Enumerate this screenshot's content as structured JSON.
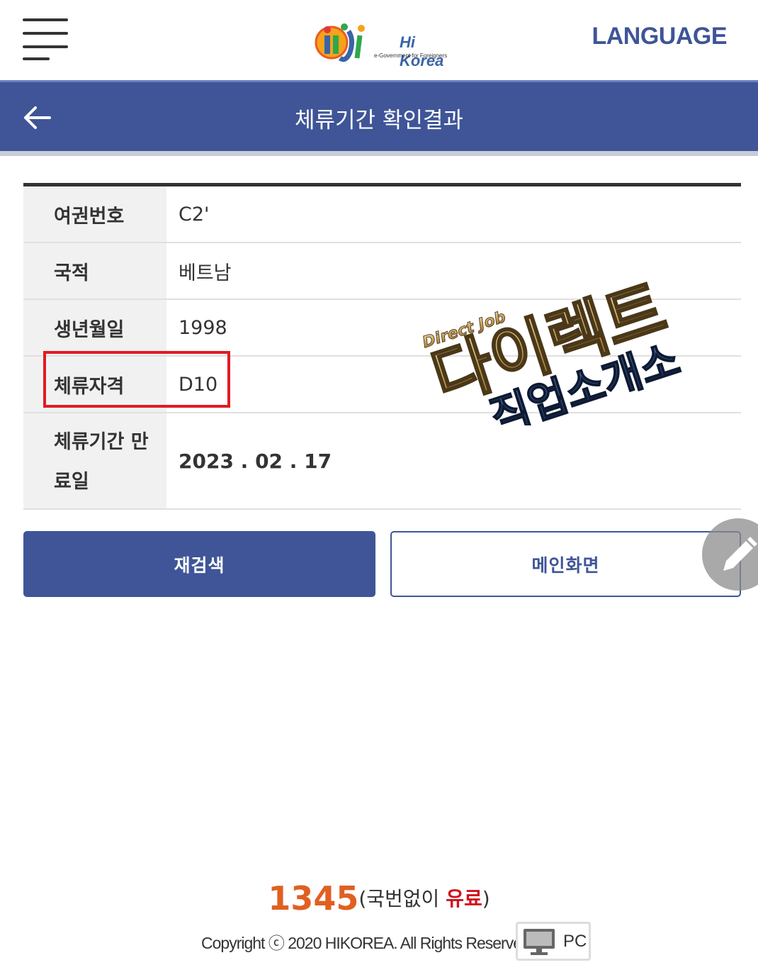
{
  "header": {
    "logo_text": "Hi Korea",
    "logo_subtitle": "e-Government for Foreigners",
    "language_label": "LANGUAGE"
  },
  "titlebar": {
    "title": "체류기간 확인결과"
  },
  "table": {
    "rows": [
      {
        "label": "여권번호",
        "value": "C2'"
      },
      {
        "label": "국적",
        "value": "베트남"
      },
      {
        "label": "생년월일",
        "value": "1998"
      },
      {
        "label": "체류자격",
        "value": "D10"
      },
      {
        "label_line1": "체류기간 만",
        "label_line2": "료일",
        "value": "2023 . 02 . 17"
      }
    ]
  },
  "watermark": {
    "top_text": "Direct Job",
    "main_text": "다이렉트",
    "sub_text": "직업소개소"
  },
  "buttons": {
    "research": "재검색",
    "main": "메인화면"
  },
  "footer": {
    "phone_number": "1345",
    "phone_prefix": "(국번없이 ",
    "phone_paid": "유료",
    "phone_suffix": ")",
    "copyright": "Copyright ⓒ 2020 HIKOREA. All Rights Reserved.",
    "pc_label": "PC"
  },
  "colors": {
    "primary": "#3f5597",
    "highlight": "#e01b24",
    "phone_accent": "#e06020"
  }
}
